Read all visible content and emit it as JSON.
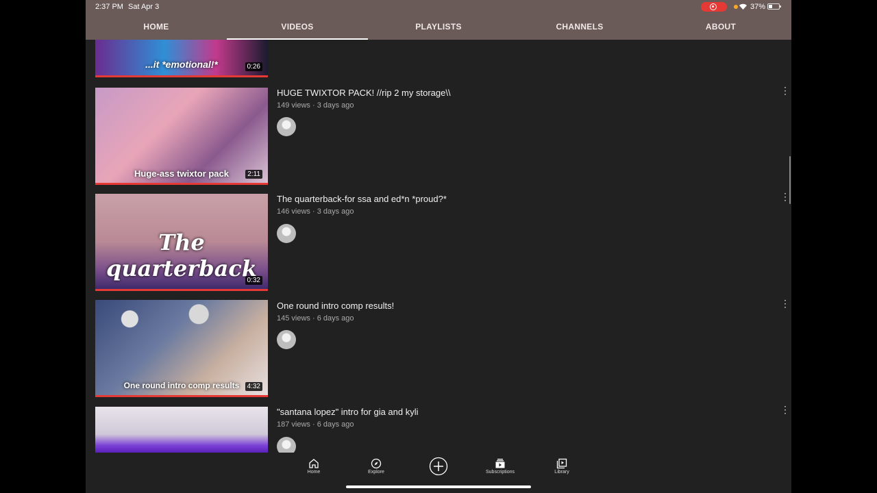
{
  "status": {
    "time": "2:37 PM",
    "date": "Sat Apr 3",
    "battery": "37%"
  },
  "tabs": [
    {
      "label": "HOME"
    },
    {
      "label": "VIDEOS",
      "active": true
    },
    {
      "label": "PLAYLISTS"
    },
    {
      "label": "CHANNELS"
    },
    {
      "label": "ABOUT"
    }
  ],
  "videos": [
    {
      "title": "",
      "meta": "",
      "duration": "0:26",
      "thumb_text": "...it *emotional!*"
    },
    {
      "title": "HUGE TWIXTOR PACK! //rip 2 my storage\\\\",
      "meta": "149 views · 3 days ago",
      "duration": "2:11",
      "thumb_text": "Huge-ass twixtor pack"
    },
    {
      "title": "The quarterback-for ssa and ed*n *proud?*",
      "meta": "146 views · 3 days ago",
      "duration": "0:32",
      "thumb_text": "The quarterback"
    },
    {
      "title": "One round intro comp results!",
      "meta": "145 views · 6 days ago",
      "duration": "4:32",
      "thumb_text": "One round intro comp results"
    },
    {
      "title": "\"santana lopez\" intro for gia and kyli",
      "meta": "187 views · 6 days ago",
      "duration": "",
      "thumb_text": ""
    }
  ],
  "bottom_nav": [
    {
      "label": "Home",
      "icon": "home-icon"
    },
    {
      "label": "Explore",
      "icon": "compass-icon"
    },
    {
      "label": "",
      "icon": "add-icon"
    },
    {
      "label": "Subscriptions",
      "icon": "subscriptions-icon"
    },
    {
      "label": "Library",
      "icon": "library-icon"
    }
  ],
  "colors": {
    "header": "#6a5a58",
    "background": "#212121",
    "progress": "#e53935"
  }
}
